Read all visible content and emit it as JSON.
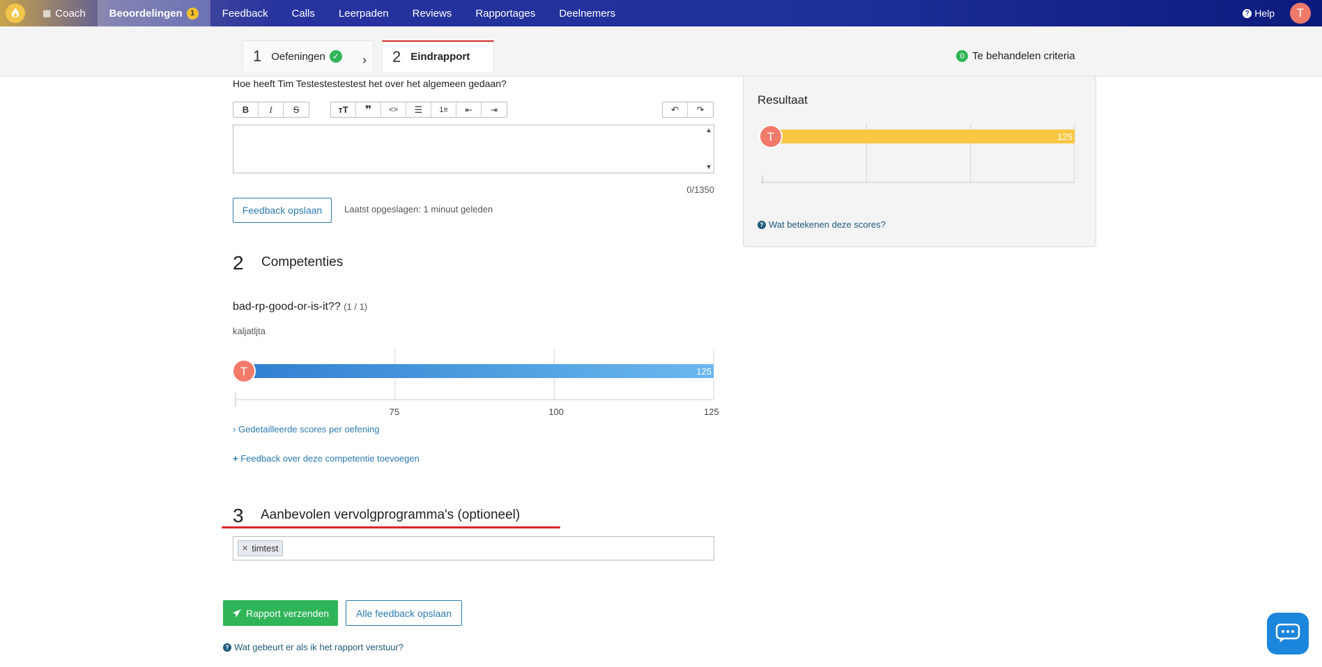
{
  "nav": {
    "items": [
      {
        "label": "Coach"
      },
      {
        "label": "Beoordelingen",
        "badge": "1"
      },
      {
        "label": "Feedback"
      },
      {
        "label": "Calls"
      },
      {
        "label": "Leerpaden"
      },
      {
        "label": "Reviews"
      },
      {
        "label": "Rapportages"
      },
      {
        "label": "Deelnemers"
      }
    ],
    "help_label": "Help",
    "avatar_initial": "T"
  },
  "steps": [
    {
      "number": "1",
      "label": "Oefeningen"
    },
    {
      "number": "2",
      "label": "Eindrapport"
    }
  ],
  "criteria": {
    "count": "0",
    "label": "Te behandelen criteria"
  },
  "general_feedback": {
    "question": "Hoe heeft Tim Testestestestest het over het algemeen gedaan?",
    "counter": "0/1350",
    "save_button": "Feedback opslaan",
    "last_saved": "Laatst opgeslagen: 1 minuut geleden"
  },
  "section2": {
    "number": "2",
    "title": "Competenties",
    "competency_name": "bad-rp-good-or-is-it??",
    "competency_count": "(1 / 1)",
    "competency_sub": "kaljatljta",
    "detail_link": "Gedetailleerde scores per oefening",
    "add_feedback_link": "Feedback over deze competentie toevoegen"
  },
  "section3": {
    "number": "3",
    "title": "Aanbevolen vervolgprogramma's (optioneel)",
    "tag": "timtest"
  },
  "actions": {
    "send_report": "Rapport verzenden",
    "save_all": "Alle feedback opslaan",
    "what_happens": "Wat gebeurt er als ik het rapport verstuur?"
  },
  "result_panel": {
    "title": "Resultaat",
    "help_link": "Wat betekenen deze scores?"
  },
  "chart_data": [
    {
      "type": "bar",
      "orientation": "horizontal",
      "values": [
        125
      ],
      "value_label": "125",
      "marker_initial": "T",
      "x_ticks": [
        "75",
        "100",
        "125"
      ],
      "xlim": [
        50,
        125
      ],
      "color": "#f9c843"
    },
    {
      "type": "bar",
      "orientation": "horizontal",
      "values": [
        125
      ],
      "value_label": "125",
      "marker_initial": "T",
      "x_ticks": [
        "75",
        "100",
        "125"
      ],
      "xlim": [
        50,
        125
      ],
      "color": "#2e86d6"
    }
  ],
  "colors": {
    "accent_blue": "#2a7ab0",
    "success_green": "#2fb558",
    "step_active_red": "#d32b2b",
    "avatar": "#f27a6b"
  }
}
